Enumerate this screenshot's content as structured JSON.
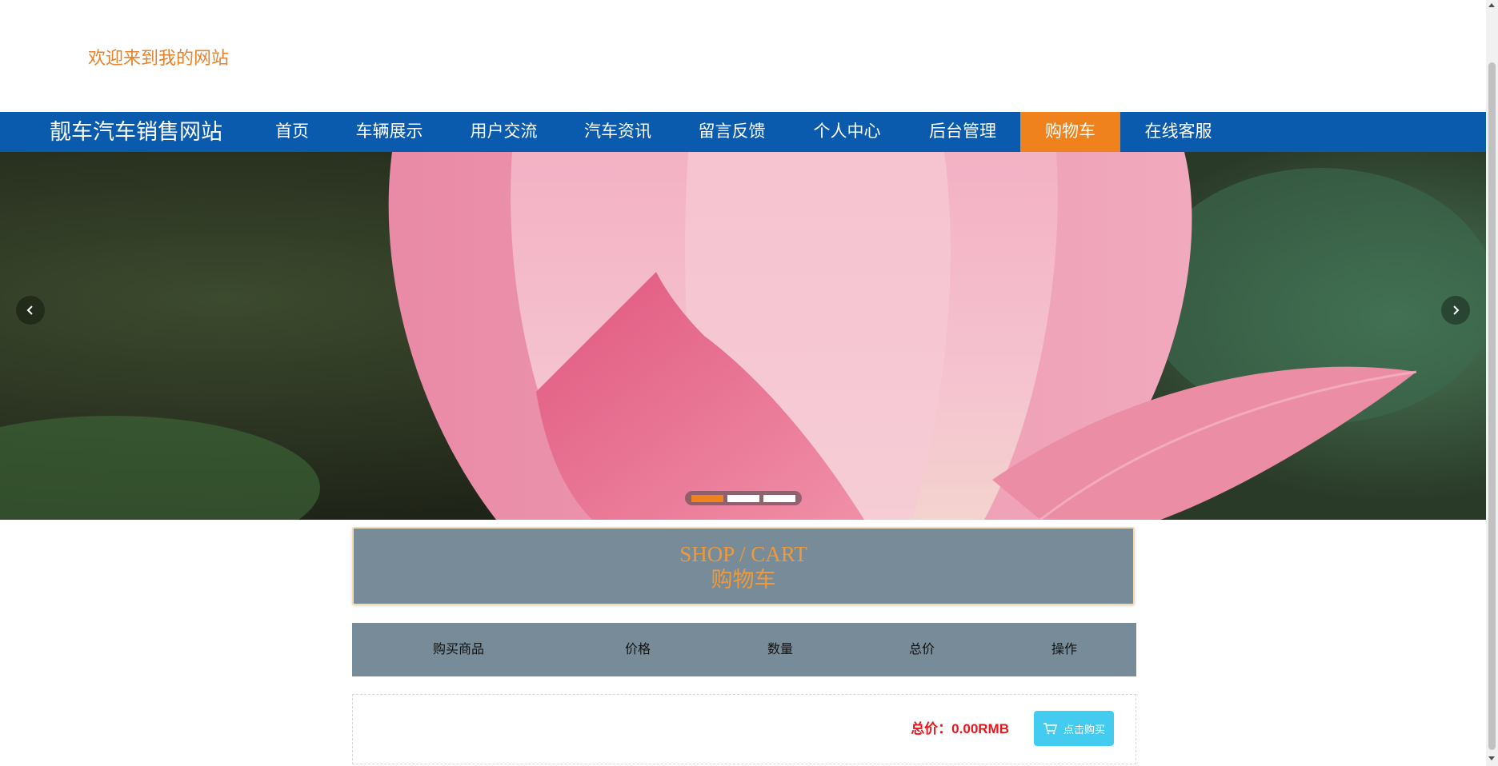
{
  "header": {
    "welcome": "欢迎来到我的网站"
  },
  "nav": {
    "brand": "靓车汽车销售网站",
    "items": [
      {
        "label": "首页"
      },
      {
        "label": "车辆展示"
      },
      {
        "label": "用户交流"
      },
      {
        "label": "汽车资讯"
      },
      {
        "label": "留言反馈"
      },
      {
        "label": "个人中心"
      },
      {
        "label": "后台管理"
      },
      {
        "label": "购物车",
        "active": true
      },
      {
        "label": "在线客服"
      }
    ]
  },
  "banner": {
    "slide_count": 3,
    "active_slide": 1,
    "prev_icon": "chevron-left-icon",
    "next_icon": "chevron-right-icon"
  },
  "cart": {
    "title_en": "SHOP / CART",
    "title_cn": "购物车",
    "columns": [
      "购买商品",
      "价格",
      "数量",
      "总价",
      "操作"
    ],
    "total_text": "总价：0.00RMB",
    "buy_label": "点击购买",
    "buy_icon": "cart-icon"
  },
  "colors": {
    "nav_bg": "#0a5aad",
    "accent": "#f0821e",
    "panel": "#788b99",
    "buy_btn": "#44ccf0",
    "total_red": "#e8151c"
  }
}
